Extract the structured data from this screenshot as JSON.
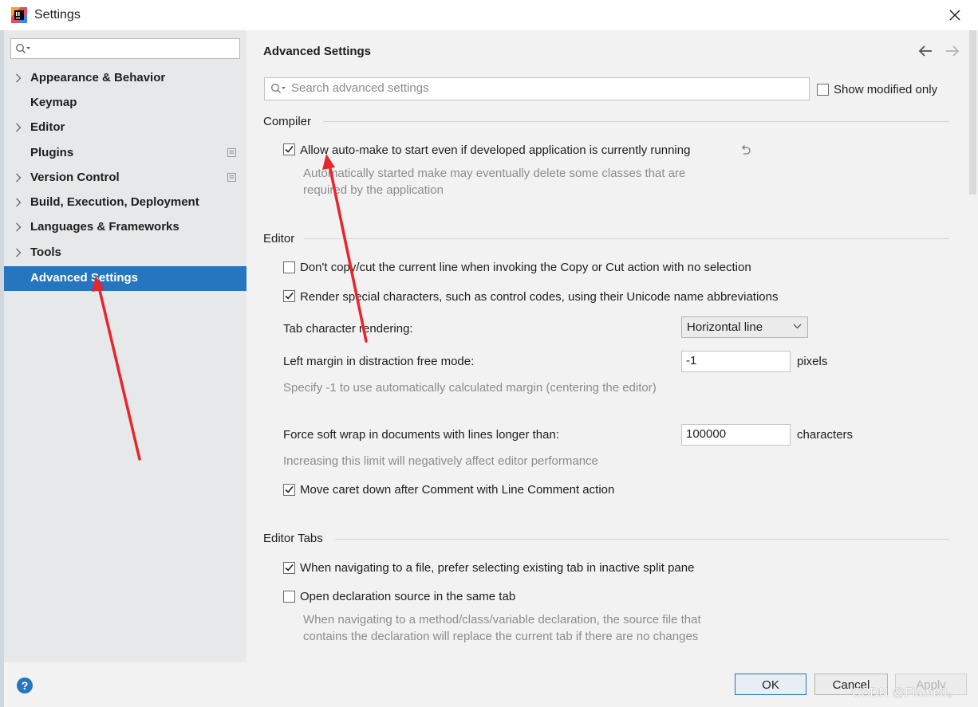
{
  "window": {
    "title": "Settings",
    "logo_icon": "intellij-idea-icon",
    "close_icon": "close-icon"
  },
  "sidebar": {
    "search_placeholder": "",
    "items": [
      {
        "label": "Appearance & Behavior",
        "expandable": true
      },
      {
        "label": "Keymap",
        "expandable": false
      },
      {
        "label": "Editor",
        "expandable": true
      },
      {
        "label": "Plugins",
        "expandable": false,
        "badge": "project-settings-icon"
      },
      {
        "label": "Version Control",
        "expandable": true,
        "badge": "project-settings-icon"
      },
      {
        "label": "Build, Execution, Deployment",
        "expandable": true
      },
      {
        "label": "Languages & Frameworks",
        "expandable": true
      },
      {
        "label": "Tools",
        "expandable": true
      },
      {
        "label": "Advanced Settings",
        "expandable": false,
        "selected": true
      }
    ]
  },
  "main": {
    "title": "Advanced Settings",
    "search": {
      "placeholder": "Search advanced settings",
      "value": ""
    },
    "show_modified_only": {
      "label": "Show modified only",
      "checked": false
    },
    "sections": {
      "compiler": {
        "title": "Compiler",
        "auto_make": {
          "label": "Allow auto-make to start even if developed application is currently running",
          "checked": true,
          "hint": "Automatically started make may eventually delete some classes that are required by the application"
        }
      },
      "editor": {
        "title": "Editor",
        "dont_copy": {
          "label": "Don't copy/cut the current line when invoking the Copy or Cut action with no selection",
          "checked": false
        },
        "render_special": {
          "label": "Render special characters, such as control codes, using their Unicode name abbreviations",
          "checked": true
        },
        "tab_rendering": {
          "label": "Tab character rendering:",
          "value": "Horizontal line"
        },
        "left_margin": {
          "label": "Left margin in distraction free mode:",
          "value": "-1",
          "unit": "pixels",
          "hint": "Specify -1 to use automatically calculated margin (centering the editor)"
        },
        "soft_wrap": {
          "label": "Force soft wrap in documents with lines longer than:",
          "value": "100000",
          "unit": "characters",
          "hint": "Increasing this limit will negatively affect editor performance"
        },
        "move_caret": {
          "label": "Move caret down after Comment with Line Comment action",
          "checked": true
        }
      },
      "editor_tabs": {
        "title": "Editor Tabs",
        "prefer_existing": {
          "label": "When navigating to a file, prefer selecting existing tab in inactive split pane",
          "checked": true
        },
        "open_same_tab": {
          "label": "Open declaration source in the same tab",
          "checked": false,
          "hint": "When navigating to a method/class/variable declaration, the source file that contains the declaration will replace the current tab if there are no changes"
        }
      }
    }
  },
  "footer": {
    "help_label": "?",
    "ok_label": "OK",
    "cancel_label": "Cancel",
    "apply_label": "Apply",
    "watermark": "CSDN @Flame0。"
  },
  "colors": {
    "accent": "#2675bf",
    "annotation_arrow": "#e8242c"
  }
}
